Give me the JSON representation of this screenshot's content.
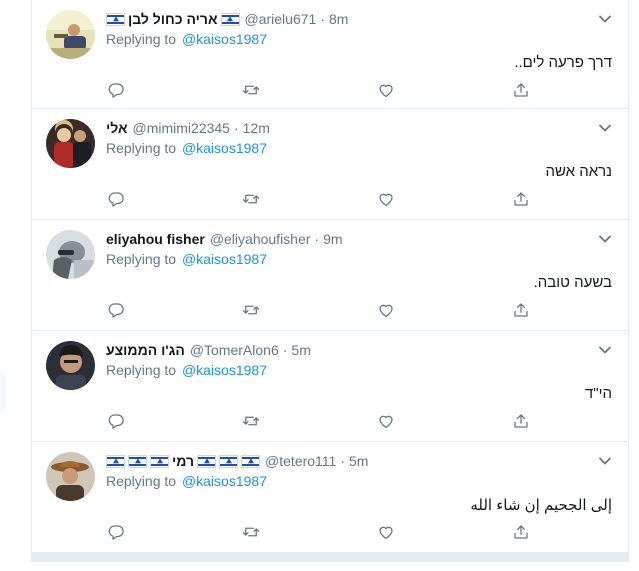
{
  "colors": {
    "link": "#1b95e0",
    "muted": "#657786",
    "border": "#e6ecf0",
    "text": "#14171a"
  },
  "icons": {
    "reply": "reply-icon",
    "retweet": "retweet-icon",
    "like": "like-icon",
    "share": "share-icon",
    "caret": "chevron-down-icon",
    "flag": "israel-flag-emoji"
  },
  "tweets": [
    {
      "name": "אריה כחול לבן",
      "name_flags": [
        "🇮🇱",
        "🇮🇱"
      ],
      "handle": "@arielu671",
      "separator": "·",
      "time": "8m",
      "replying_prefix": "Replying to",
      "replying_to": "@kaisos1987",
      "text": "דרך פרעה לים.."
    },
    {
      "name": "אלי",
      "name_flags": [],
      "handle": "@mimimi22345",
      "separator": "·",
      "time": "12m",
      "replying_prefix": "Replying to",
      "replying_to": "@kaisos1987",
      "text": "נראה אשה"
    },
    {
      "name": "eliyahou fisher",
      "name_flags": [],
      "handle": "@eliyahoufisher",
      "separator": "·",
      "time": "9m",
      "replying_prefix": "Replying to",
      "replying_to": "@kaisos1987",
      "text": "בשעה טובה."
    },
    {
      "name": "הג'ו הממוצע",
      "name_flags": [],
      "handle": "@TomerAlon6",
      "separator": "·",
      "time": "5m",
      "replying_prefix": "Replying to",
      "replying_to": "@kaisos1987",
      "text": "הי\"ד"
    },
    {
      "name": "רמי",
      "name_flags": [
        "🇮🇱",
        "🇮🇱",
        "🇮🇱",
        "🇮🇱",
        "🇮🇱",
        "🇮🇱"
      ],
      "handle": "@tetero111",
      "separator": "·",
      "time": "5m",
      "replying_prefix": "Replying to",
      "replying_to": "@kaisos1987",
      "text": "إلى الجحيم إن شاء الله"
    }
  ]
}
